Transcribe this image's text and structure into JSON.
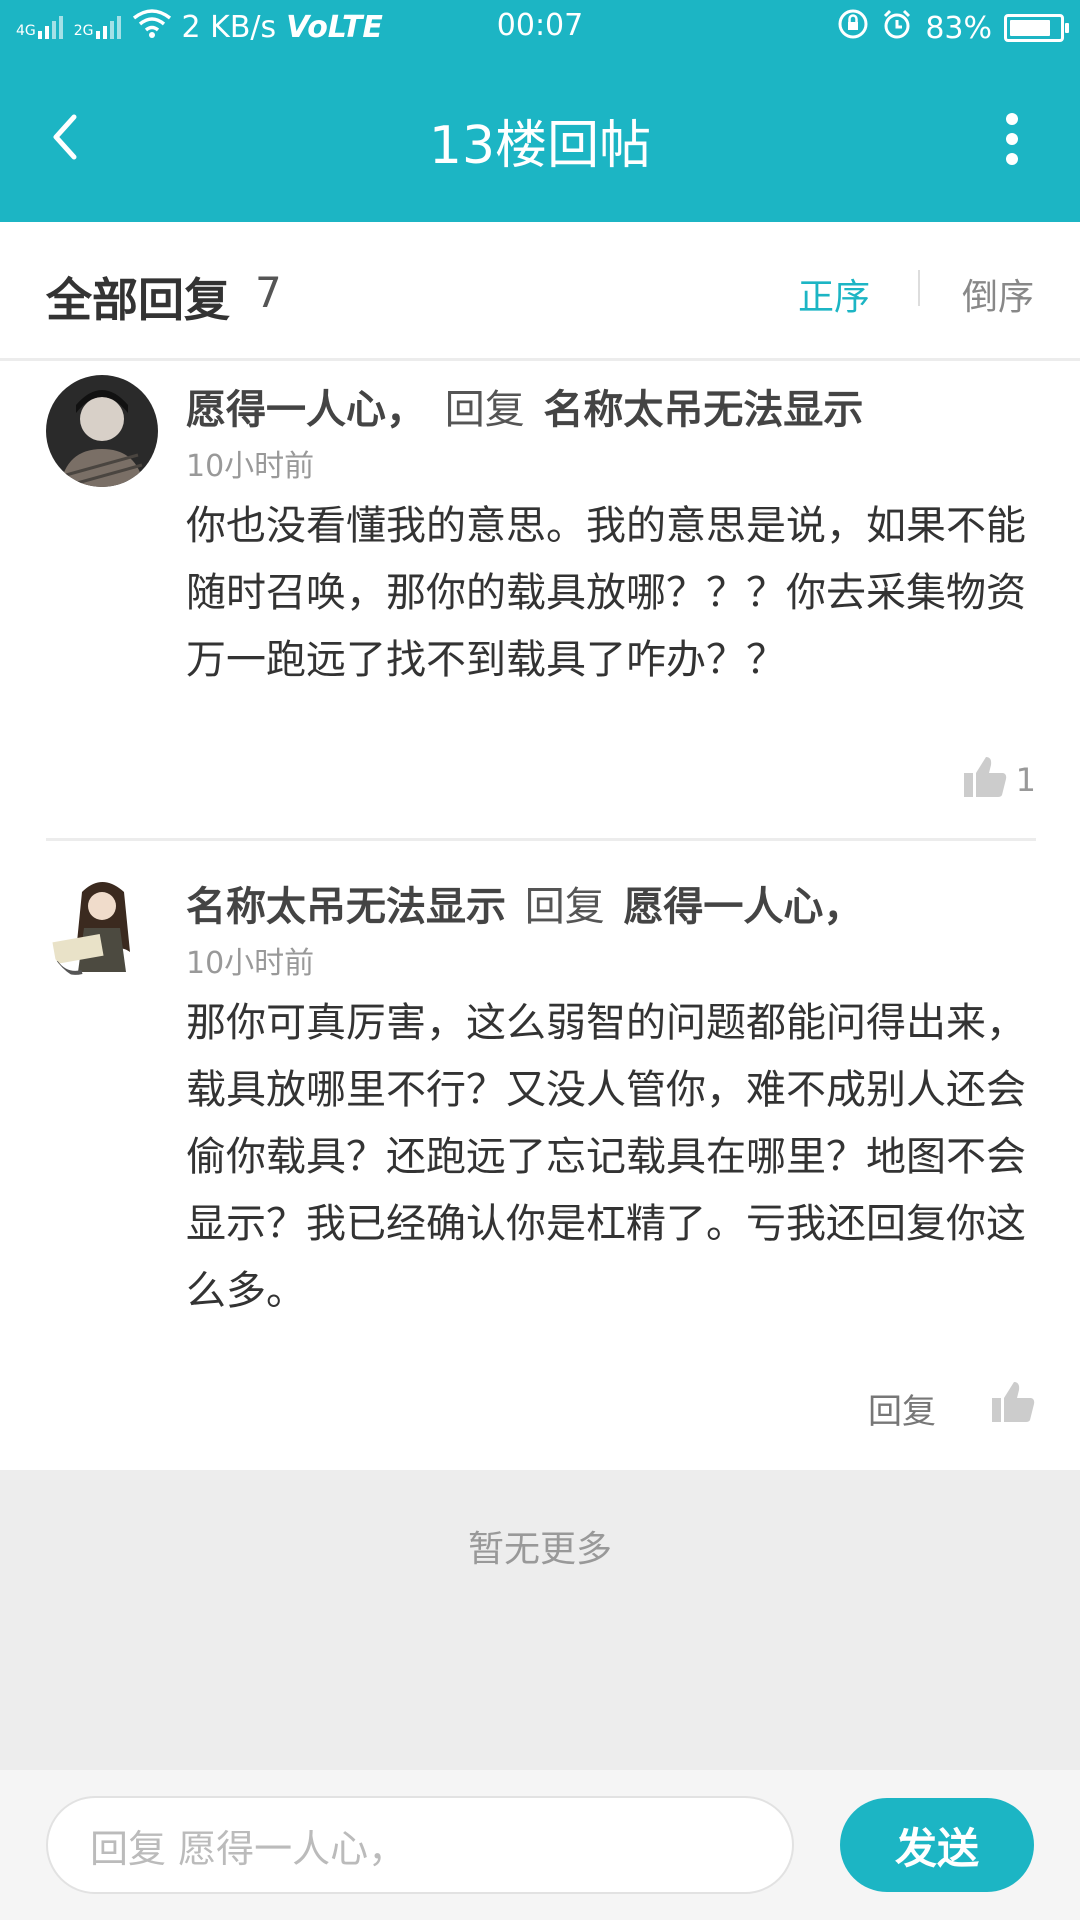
{
  "status_bar": {
    "signal_1": "4G",
    "signal_2": "2G",
    "net_speed": "2 KB/s",
    "volte": "VoLTE",
    "time": "00:07",
    "battery": "83%",
    "battery_level": 0.83
  },
  "app_bar": {
    "title": "13楼回帖",
    "back_icon": "chevron-left-icon",
    "more_icon": "more-vertical-icon"
  },
  "header": {
    "title": "全部回复",
    "count": "7",
    "sort_asc": "正序",
    "sort_desc": "倒序"
  },
  "comments": [
    {
      "username": "愿得一人心，",
      "reply_word": "回复",
      "reply_to": "名称太吊无法显示",
      "time": "10小时前",
      "body": "你也没看懂我的意思。我的意思是说，如果不能随时召唤，那你的载具放哪？？？你去采集物资万一跑远了找不到载具了咋办？？",
      "likes": "1"
    },
    {
      "username": "名称太吊无法显示",
      "reply_word": "回复",
      "reply_to": "愿得一人心，",
      "time": "10小时前",
      "body": "那你可真厉害，这么弱智的问题都能问得出来，载具放哪里不行？又没人管你，难不成别人还会偷你载具？还跑远了忘记载具在哪里？地图不会显示？我已经确认你是杠精了。亏我还回复你这么多。",
      "reply_button": "回复"
    }
  ],
  "footer": {
    "no_more": "暂无更多",
    "input_placeholder": "回复 愿得一人心，",
    "send": "发送"
  },
  "colors": {
    "accent": "#1cb5c4"
  }
}
